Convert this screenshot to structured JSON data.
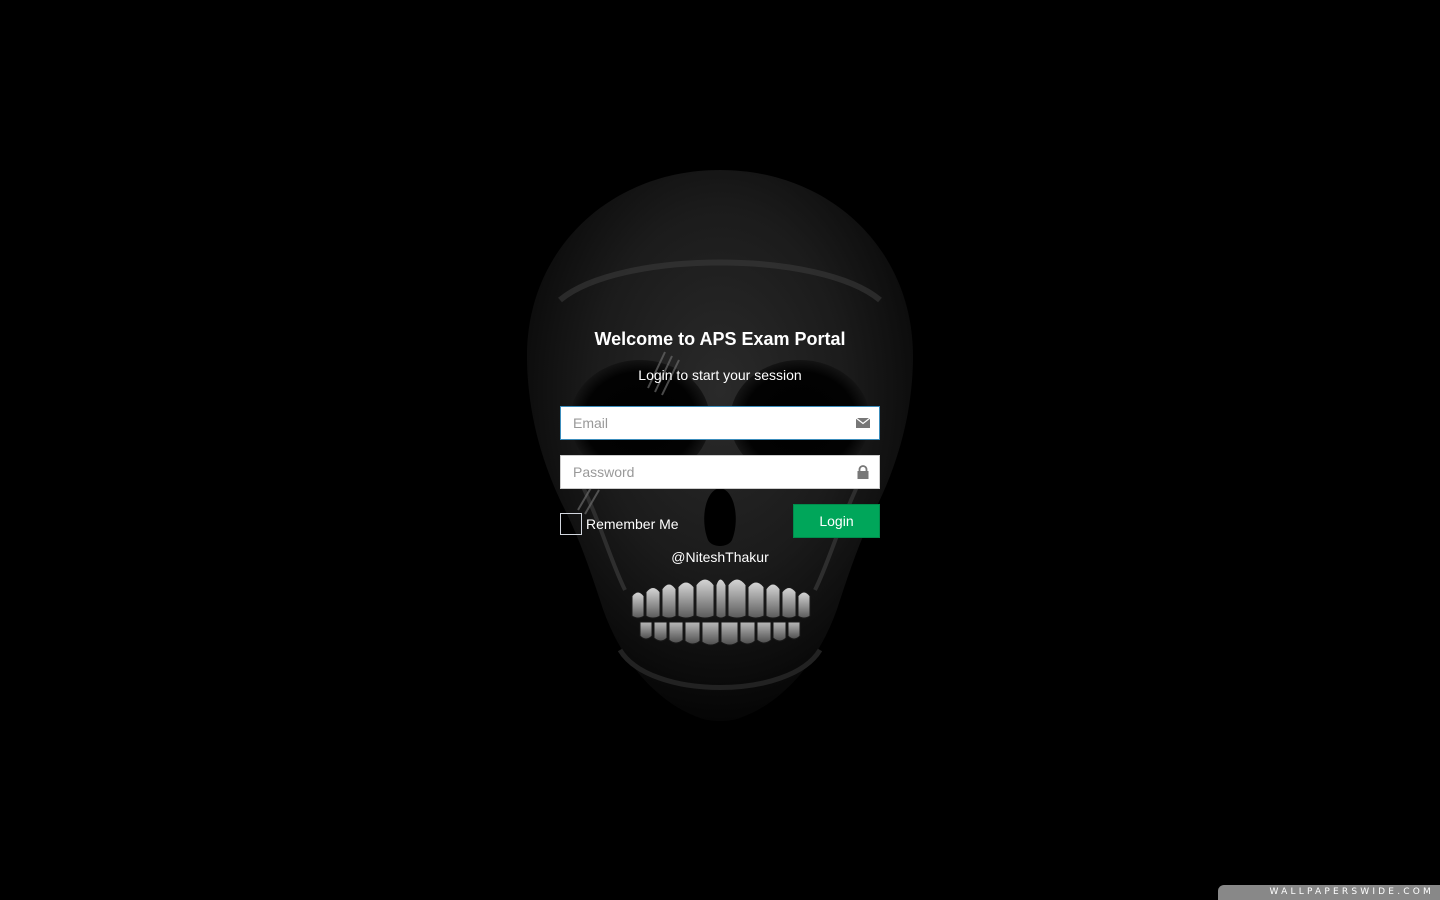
{
  "login": {
    "title": "Welcome to APS Exam Portal",
    "subtitle": "Login to start your session",
    "email": {
      "placeholder": "Email",
      "value": "",
      "icon": "envelope-icon"
    },
    "password": {
      "placeholder": "Password",
      "value": "",
      "icon": "lock-icon"
    },
    "remember_label": "Remember Me",
    "remember_checked": false,
    "login_button": "Login",
    "credit": "@NiteshThakur"
  },
  "background": {
    "image": "skull-wallpaper",
    "watermark": "WALLPAPERSWIDE.COM"
  },
  "colors": {
    "background": "#000000",
    "button": "#00a65a",
    "focus_border": "#3c8dbc"
  }
}
